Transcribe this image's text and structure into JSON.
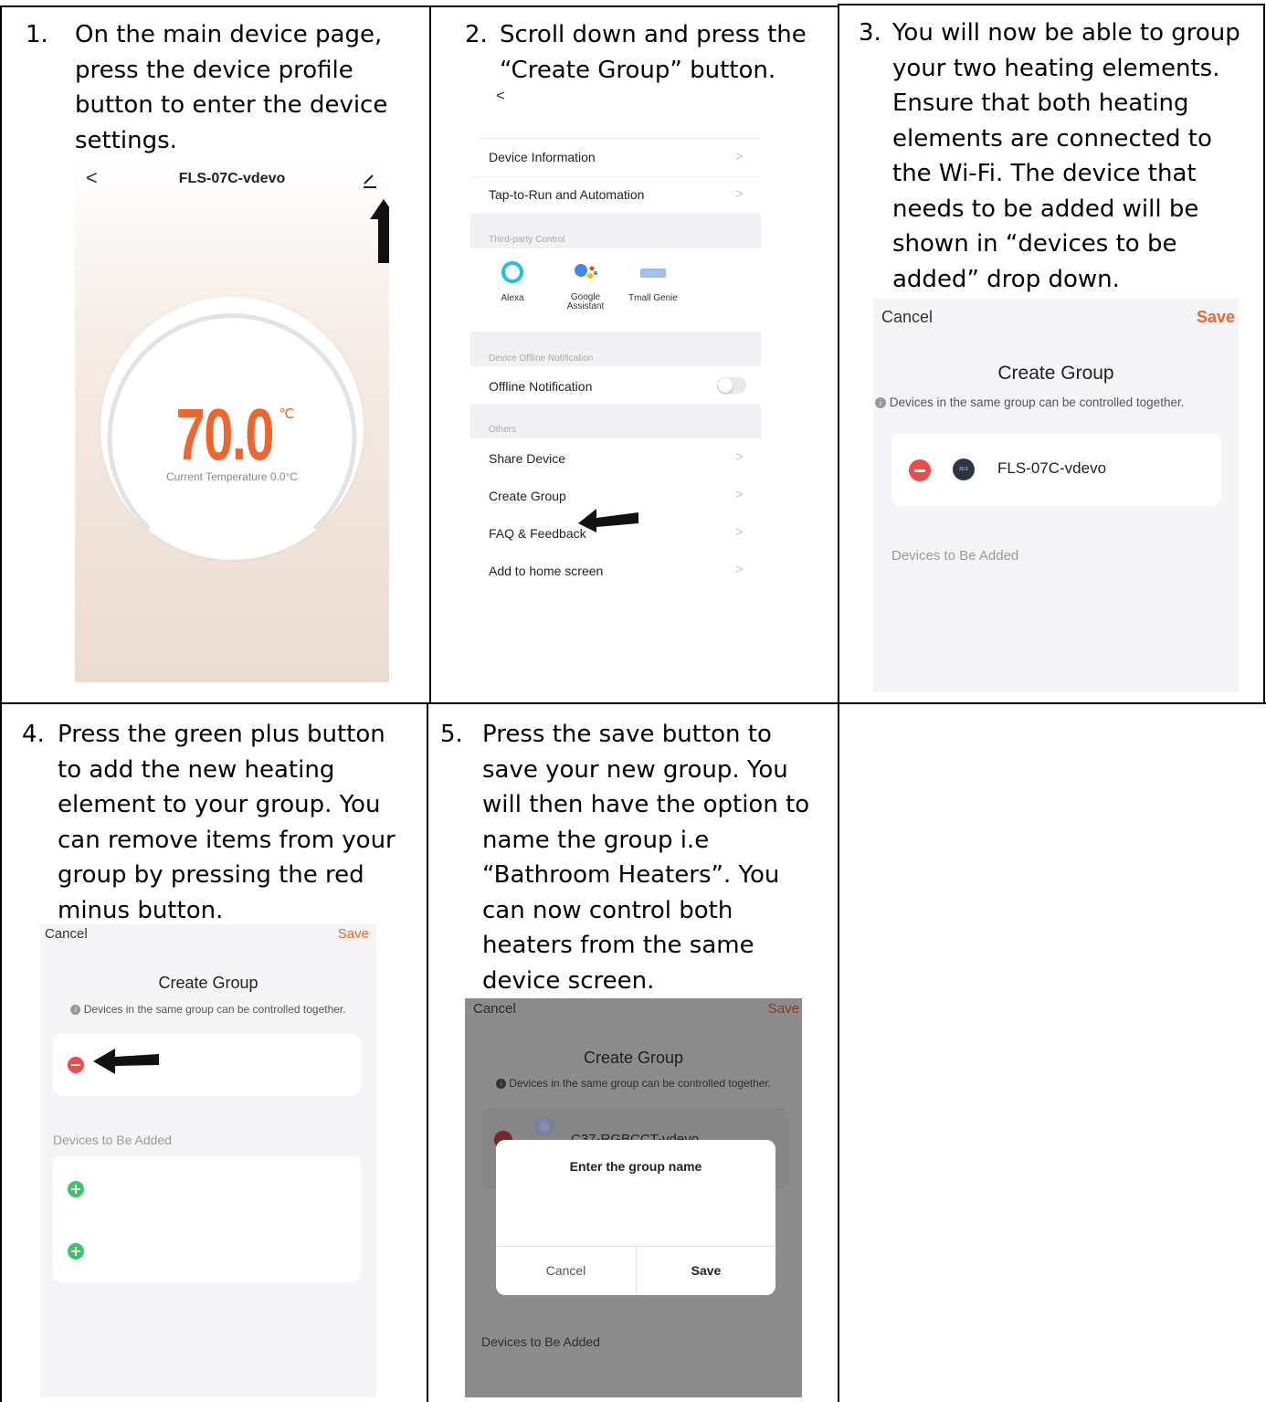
{
  "steps": {
    "s1": {
      "num": "1.",
      "lines": [
        "On the main device page,",
        "press the device profile",
        "button to enter the device",
        "settings."
      ]
    },
    "s2": {
      "num": "2.",
      "lines": [
        "Scroll down and press the",
        "“Create Group” button."
      ]
    },
    "s3": {
      "num": "3.",
      "lines": [
        "You will now be able to group",
        "your two heating elements.",
        "Ensure that both heating",
        "elements are connected to",
        "the Wi-Fi. The device that",
        "needs to be added will be",
        "shown in “devices to be",
        "added” drop down."
      ]
    },
    "s4": {
      "num": "4.",
      "lines": [
        "Press the green plus button",
        "to add the new heating",
        "element to your group. You",
        "can remove items from your",
        "group by pressing the red",
        "minus button."
      ]
    },
    "s5": {
      "num": "5.",
      "lines": [
        "Press the save button to",
        "save your new group. You",
        "will then have the option to",
        "name the group i.e",
        "“Bathroom Heaters”. You",
        "can now control both",
        "heaters from the same",
        "device screen."
      ]
    }
  },
  "shot1": {
    "back": "<",
    "title": "FLS-07C-vdevo",
    "temp": "70.0",
    "unit": "℃",
    "current": "Current Temperature 0.0°C",
    "icons": [
      "chevron-left-icon",
      "edit-pencil-icon",
      "arrow-up-icon"
    ]
  },
  "shot2": {
    "back": "<",
    "rows_top": [
      "Device Information",
      "Tap-to-Run and Automation"
    ],
    "section_third": "Third-party Control",
    "services": [
      "Alexa",
      "Google\nAssistant",
      "Tmall Genie"
    ],
    "section_offline": "Device Offline Notification",
    "offline_label": "Offline Notification",
    "section_others": "Others",
    "rows_bottom": [
      "Share Device",
      "Create Group",
      "FAQ & Feedback",
      "Add to home screen"
    ],
    "chevron": ">",
    "colors": {
      "alexa": "#1ec0ea",
      "google_blue": "#4285f4",
      "google_red": "#ea4335",
      "google_yellow": "#fbbc05",
      "google_green": "#34a853",
      "tmall": "#5b8de8"
    }
  },
  "shot3": {
    "cancel": "Cancel",
    "save": "Save",
    "title": "Create Group",
    "info": "Devices in the same group can be controlled together.",
    "device": "FLS-07C-vdevo",
    "to_add": "Devices to Be Added",
    "device_icon_text": "20.5",
    "colors": {
      "save": "#f0642d",
      "minus": "#f04b4b"
    }
  },
  "shot4": {
    "cancel": "Cancel",
    "save": "Save",
    "title": "Create Group",
    "info": "Devices in the same group can be controlled together.",
    "to_add": "Devices to Be Added",
    "colors": {
      "plus": "#3dc46a"
    }
  },
  "shot5": {
    "cancel": "Cancel",
    "save": "Save",
    "title": "Create Group",
    "info": "Devices in the same group can be controlled together.",
    "device": "C37-RGBCCT-vdevo",
    "dialog_title": "Enter the group name",
    "dialog_cancel": "Cancel",
    "dialog_save": "Save",
    "to_add": "Devices to Be Added"
  }
}
